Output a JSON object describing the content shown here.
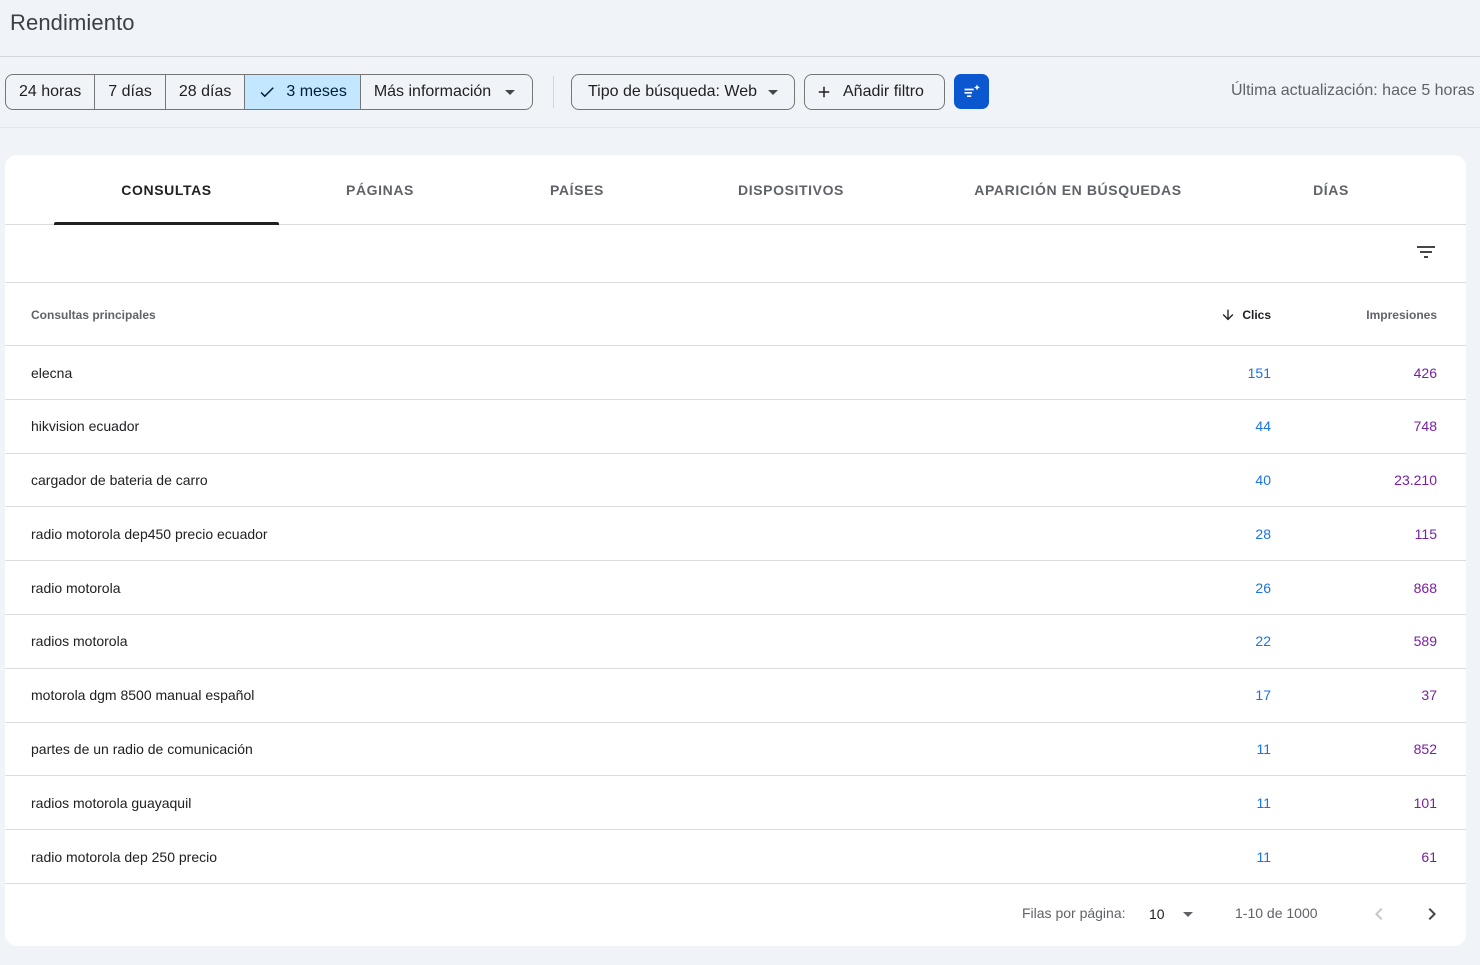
{
  "header": {
    "title": "Rendimiento"
  },
  "toolbar": {
    "ranges": [
      {
        "label": "24 horas",
        "selected": false
      },
      {
        "label": "7 días",
        "selected": false
      },
      {
        "label": "28 días",
        "selected": false
      },
      {
        "label": "3 meses",
        "selected": true
      },
      {
        "label": "Más información",
        "selected": false
      }
    ],
    "search_type": "Tipo de búsqueda: Web",
    "add_filter": "Añadir filtro",
    "last_update": "Última actualización: hace 5 horas",
    "accent_color": "#0b57d0",
    "selected_color": "#c2e7ff"
  },
  "tabs": [
    {
      "label": "CONSULTAS",
      "active": true
    },
    {
      "label": "PÁGINAS",
      "active": false
    },
    {
      "label": "PAÍSES",
      "active": false
    },
    {
      "label": "DISPOSITIVOS",
      "active": false
    },
    {
      "label": "APARICIÓN EN BÚSQUEDAS",
      "active": false
    },
    {
      "label": "DÍAS",
      "active": false
    }
  ],
  "table": {
    "columns": {
      "query": "Consultas principales",
      "clicks": "Clics",
      "impressions": "Impresiones"
    },
    "sort": {
      "column": "clicks",
      "direction": "desc"
    },
    "clicks_color": "#1a73e8",
    "impressions_color": "#7b1fa2",
    "rows": [
      {
        "query": "elecna",
        "clicks": "151",
        "impressions": "426"
      },
      {
        "query": "hikvision ecuador",
        "clicks": "44",
        "impressions": "748"
      },
      {
        "query": "cargador de bateria de carro",
        "clicks": "40",
        "impressions": "23.210"
      },
      {
        "query": "radio motorola dep450 precio ecuador",
        "clicks": "28",
        "impressions": "115"
      },
      {
        "query": "radio motorola",
        "clicks": "26",
        "impressions": "868"
      },
      {
        "query": "radios motorola",
        "clicks": "22",
        "impressions": "589"
      },
      {
        "query": "motorola dgm 8500 manual español",
        "clicks": "17",
        "impressions": "37"
      },
      {
        "query": "partes de un radio de comunicación",
        "clicks": "11",
        "impressions": "852"
      },
      {
        "query": "radios motorola guayaquil",
        "clicks": "11",
        "impressions": "101"
      },
      {
        "query": "radio motorola dep 250 precio",
        "clicks": "11",
        "impressions": "61"
      }
    ]
  },
  "pagination": {
    "rows_per_page_label": "Filas por página:",
    "rows_per_page": "10",
    "range": "1-10 de 1000"
  },
  "icons": {
    "check": "check-icon",
    "dropdown": "arrow-drop-down-icon",
    "add": "plus-icon",
    "ai_filter": "filter-sparkle-icon",
    "filter_rows": "filter-list-icon",
    "sort": "arrow-downward-icon",
    "prev": "chevron-left-icon",
    "next": "chevron-right-icon"
  }
}
